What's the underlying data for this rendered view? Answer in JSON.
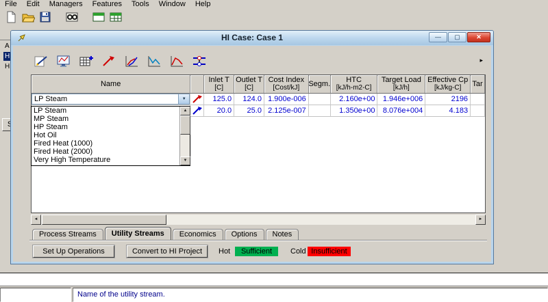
{
  "colors": {
    "value_text": "#0000d0",
    "sufficient_bg": "#00b050",
    "insufficient_bg": "#ff0000",
    "hint_text": "#00008b",
    "hot_stream": "#cc0000",
    "cold_stream": "#0000cc",
    "titlebar": "#bed8ee"
  },
  "icons": {
    "up_arrow": "▲",
    "down_arrow": "▼",
    "left_arrow": "◄",
    "right_arrow": "►",
    "dropdown_arrow": "▼",
    "overflow_arrow": "▸"
  },
  "menubar": {
    "items": [
      "File",
      "Edit",
      "Managers",
      "Features",
      "Tools",
      "Window",
      "Help"
    ]
  },
  "toolbar": {
    "icons": [
      "new-document",
      "open-folder",
      "save",
      "workbook",
      "green-window",
      "green-grid-window"
    ]
  },
  "left_panel": {
    "items": [
      "A",
      "H",
      "H"
    ],
    "button_label": "S"
  },
  "window": {
    "title": "HI Case: Case 1",
    "controls": {
      "minimize": "—",
      "maximize": "▢",
      "close": "✕"
    },
    "toolbar_icons": [
      "pen",
      "plot-monitor",
      "table-add",
      "stream-arrow",
      "composite-curves",
      "grand-composite",
      "driving-force",
      "exchanger-network"
    ]
  },
  "table": {
    "columns": [
      {
        "label": "Name",
        "sub": ""
      },
      {
        "label": "",
        "sub": ""
      },
      {
        "label": "Inlet T",
        "sub": "[C]"
      },
      {
        "label": "Outlet T",
        "sub": "[C]"
      },
      {
        "label": "Cost Index",
        "sub": "[Cost/kJ]"
      },
      {
        "label": "Segm.",
        "sub": ""
      },
      {
        "label": "HTC",
        "sub": "[kJ/h-m2-C]"
      },
      {
        "label": "Target Load",
        "sub": "[kJ/h]"
      },
      {
        "label": "Effective Cp",
        "sub": "[kJ/kg-C]"
      },
      {
        "label": "Tar",
        "sub": ""
      }
    ],
    "rows": [
      {
        "name": "LP Steam",
        "stream_type": "hot",
        "inlet_t": "125.0",
        "outlet_t": "124.0",
        "cost_index": "1.900e-006",
        "segm": "",
        "htc": "2.160e+00",
        "target_load": "1.946e+006",
        "effective_cp": "2196"
      },
      {
        "name": "",
        "stream_type": "cold",
        "inlet_t": "20.0",
        "outlet_t": "25.0",
        "cost_index": "2.125e-007",
        "segm": "",
        "htc": "1.350e+00",
        "target_load": "8.076e+004",
        "effective_cp": "4.183"
      }
    ]
  },
  "combo": {
    "value": "LP Steam",
    "options": [
      "LP Steam",
      "MP Steam",
      "HP Steam",
      "Hot Oil",
      "Fired Heat (1000)",
      "Fired Heat (2000)",
      "Very High Temperature"
    ]
  },
  "tabs": {
    "items": [
      "Process Streams",
      "Utility Streams",
      "Economics",
      "Options",
      "Notes"
    ],
    "active": "Utility Streams"
  },
  "actions": {
    "setup_label": "Set Up Operations",
    "convert_label": "Convert to HI Project"
  },
  "status": {
    "hot_label": "Hot",
    "hot_value": "Sufficient",
    "cold_label": "Cold",
    "cold_value": "Insufficient"
  },
  "statusbar": {
    "hint": "Name of the utility stream."
  }
}
